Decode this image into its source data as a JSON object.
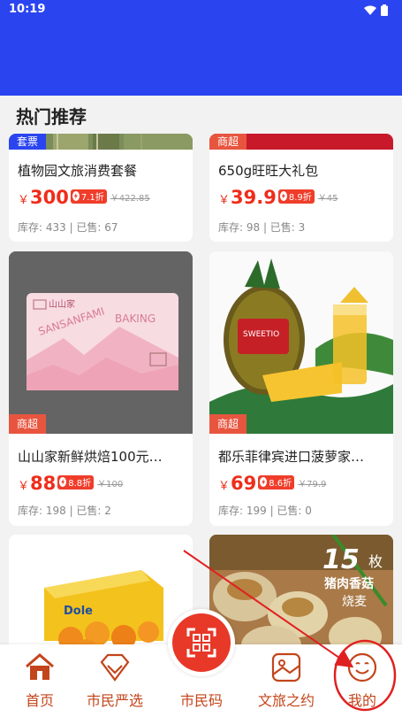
{
  "status": {
    "time": "10:19"
  },
  "section_title": "热门推荐",
  "products": [
    {
      "badge": "套票",
      "name": "植物园文旅消费套餐",
      "yen": "￥",
      "price": "300",
      "discount": "7.1折",
      "original": "￥422.85",
      "stock": "库存: 433 | 已售: 67"
    },
    {
      "badge": "商超",
      "name": "650g旺旺大礼包",
      "yen": "￥",
      "price": "39.9",
      "discount": "8.9折",
      "original": "￥45",
      "stock": "库存: 98 | 已售: 3"
    },
    {
      "badge": "商超",
      "name": "山山家新鲜烘焙100元…",
      "yen": "￥",
      "price": "88",
      "discount": "8.8折",
      "original": "￥100",
      "stock": "库存: 198 | 已售: 2",
      "image_text": {
        "brand": "山山家",
        "line1": "SANSANFAMI",
        "line2": "BAKING"
      }
    },
    {
      "badge": "商超",
      "name": "都乐菲律宾进口菠萝家…",
      "yen": "￥",
      "price": "69",
      "discount": "8.6折",
      "original": "￥79.9",
      "stock": "库存: 199 | 已售: 0",
      "image_text": {
        "label": "SWEETIO"
      }
    },
    {
      "image_text": {
        "brand": "Dole"
      }
    },
    {
      "image_text": {
        "count": "15",
        "unit": "枚",
        "line1": "猪肉香菇",
        "line2": "烧麦"
      }
    }
  ],
  "tabs": [
    {
      "label": "首页"
    },
    {
      "label": "市民严选"
    },
    {
      "label": "市民码"
    },
    {
      "label": "文旅之约"
    },
    {
      "label": "我的"
    }
  ],
  "colors": {
    "brand_blue": "#2a45ef",
    "price_red": "#ef2d1a",
    "tab_orange": "#c3451b",
    "annotation_red": "#e02020"
  }
}
